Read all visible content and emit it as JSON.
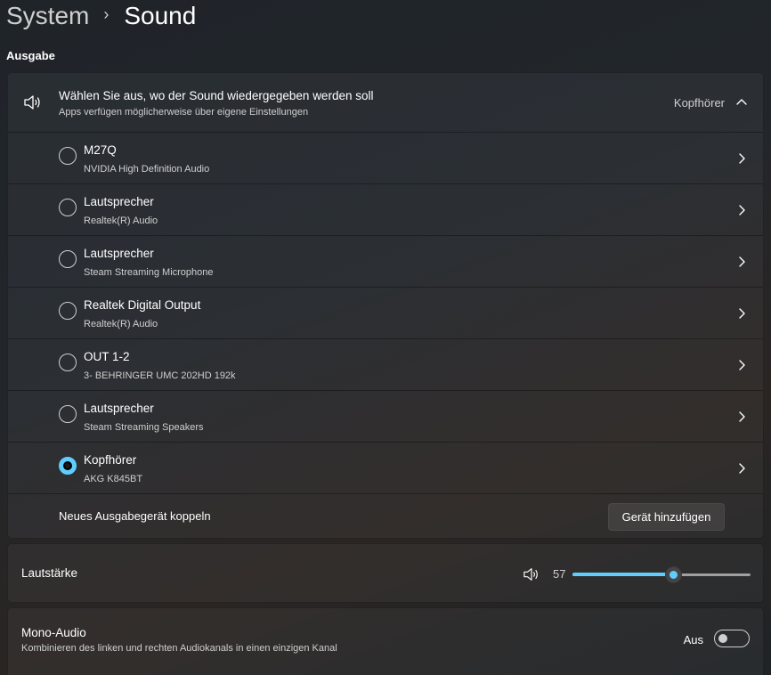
{
  "breadcrumb": {
    "parent": "System",
    "separator": "›",
    "current": "Sound"
  },
  "section_title": "Ausgabe",
  "output": {
    "title": "Wählen Sie aus, wo der Sound wiedergegeben werden soll",
    "subtitle": "Apps verfügen möglicherweise über eigene Einstellungen",
    "selected": "Kopfhörer",
    "devices": [
      {
        "name": "M27Q",
        "detail": "NVIDIA High Definition Audio",
        "selected": false
      },
      {
        "name": "Lautsprecher",
        "detail": "Realtek(R) Audio",
        "selected": false
      },
      {
        "name": "Lautsprecher",
        "detail": "Steam Streaming Microphone",
        "selected": false
      },
      {
        "name": "Realtek Digital Output",
        "detail": "Realtek(R) Audio",
        "selected": false
      },
      {
        "name": "OUT 1-2",
        "detail": "3- BEHRINGER UMC 202HD 192k",
        "selected": false
      },
      {
        "name": "Lautsprecher",
        "detail": "Steam Streaming Speakers",
        "selected": false
      },
      {
        "name": "Kopfhörer",
        "detail": "AKG K845BT",
        "selected": true
      }
    ],
    "pair_label": "Neues Ausgabegerät koppeln",
    "add_button": "Gerät hinzufügen"
  },
  "volume": {
    "label": "Lautstärke",
    "value": "57",
    "fraction": 0.57
  },
  "mono": {
    "title": "Mono-Audio",
    "subtitle": "Kombinieren des linken und rechten Audiokanals in einen einzigen Kanal",
    "state": "Aus",
    "on": false
  },
  "colors": {
    "accent": "#60cdff",
    "text": "#ffffff",
    "secondary_text": "#cfcfcf"
  },
  "icons": {
    "speaker": "speaker-icon",
    "chevron_up": "chevron-up-icon",
    "chevron_right": "chevron-right-icon"
  }
}
